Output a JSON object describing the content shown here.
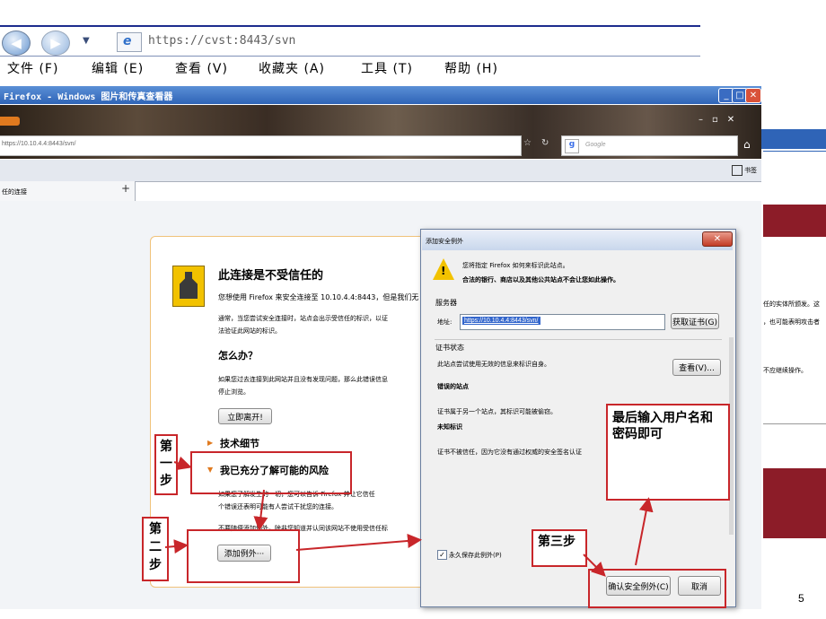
{
  "ie": {
    "address": "https://cvst:8443/svn",
    "menu": [
      "文件 (F)",
      "编辑 (E)",
      "查看 (V)",
      "收藏夹 (A)",
      "工具 (T)",
      "帮助 (H)"
    ]
  },
  "viewer": {
    "title": "Firefox - Windows 图片和传真查看器"
  },
  "firefox": {
    "url": "https://10.10.4.4:8443/svn/",
    "search_placeholder": "Google",
    "tab_label": "任的连接",
    "bookmarks_label": "书签",
    "new_tab": "+"
  },
  "error_page": {
    "title": "此连接是不受信任的",
    "intro": "您想使用 Firefox 来安全连接至 10.10.4.4:8443，但是我们无",
    "para1_line1": "通常，当您尝试安全连接时，站点会出示受信任的标识，以证",
    "para1_line2": "法验证此网站的标识。",
    "what_heading": "怎么办？",
    "para2_line1": "如果您过去连接到此网站并且没有发现问题，那么此错误信息",
    "para2_line2": "停止浏览。",
    "leave_button": "立即离开!",
    "tech_details": "技术细节",
    "risks": "我已充分了解可能的风险",
    "risk_line1": "如果您了解发生的一切，您可以告诉 Firefox 并让它信任",
    "risk_line2": "个错误还表明可能有人尝试干扰您的连接。",
    "risk_line3": "不要随便添加例外，除非您知道并认同该网站不使用受信任标",
    "add_exception": "添加例外···"
  },
  "dialog": {
    "title": "添加安全例外",
    "warn_line1": "您将指定 Firefox 如何来标识此站点。",
    "warn_line2": "合法的银行、商店以及其他公共站点不会让您如此操作。",
    "server_label": "服务器",
    "location_label": "地址:",
    "location_value": "https://10.10.4.4:8443/svn/",
    "get_cert": "获取证书(G)",
    "cert_status_label": "证书状态",
    "cert_status_text": "此站点尝试使用无效的信息来标识自身。",
    "view_button": "查看(V)...",
    "wrong_site": "错误的站点",
    "wrong_site_text": "证书属于另一个站点，其标识可能被偷窃。",
    "unknown_id": "未知标识",
    "unknown_text": "证书不被信任，因为它没有通过权威的安全签名认证",
    "permanent": "永久保存此例外(P)",
    "confirm": "确认安全例外(C)",
    "cancel": "取消"
  },
  "right_slide": {
    "line1": "任的实体所颁发。这",
    "line2": "，也可能表明攻击者",
    "line3": "不应继续操作。"
  },
  "annotations": {
    "step1": [
      "第",
      "一",
      "步"
    ],
    "step2": [
      "第",
      "二",
      "步"
    ],
    "step3": "第三步",
    "final": "最后输入用户名和密码即可"
  },
  "page_number": "5",
  "colors": {
    "annotation_red": "#c8262a",
    "ie_blue": "#1d2c8e",
    "slide_red": "#8c1c28"
  }
}
